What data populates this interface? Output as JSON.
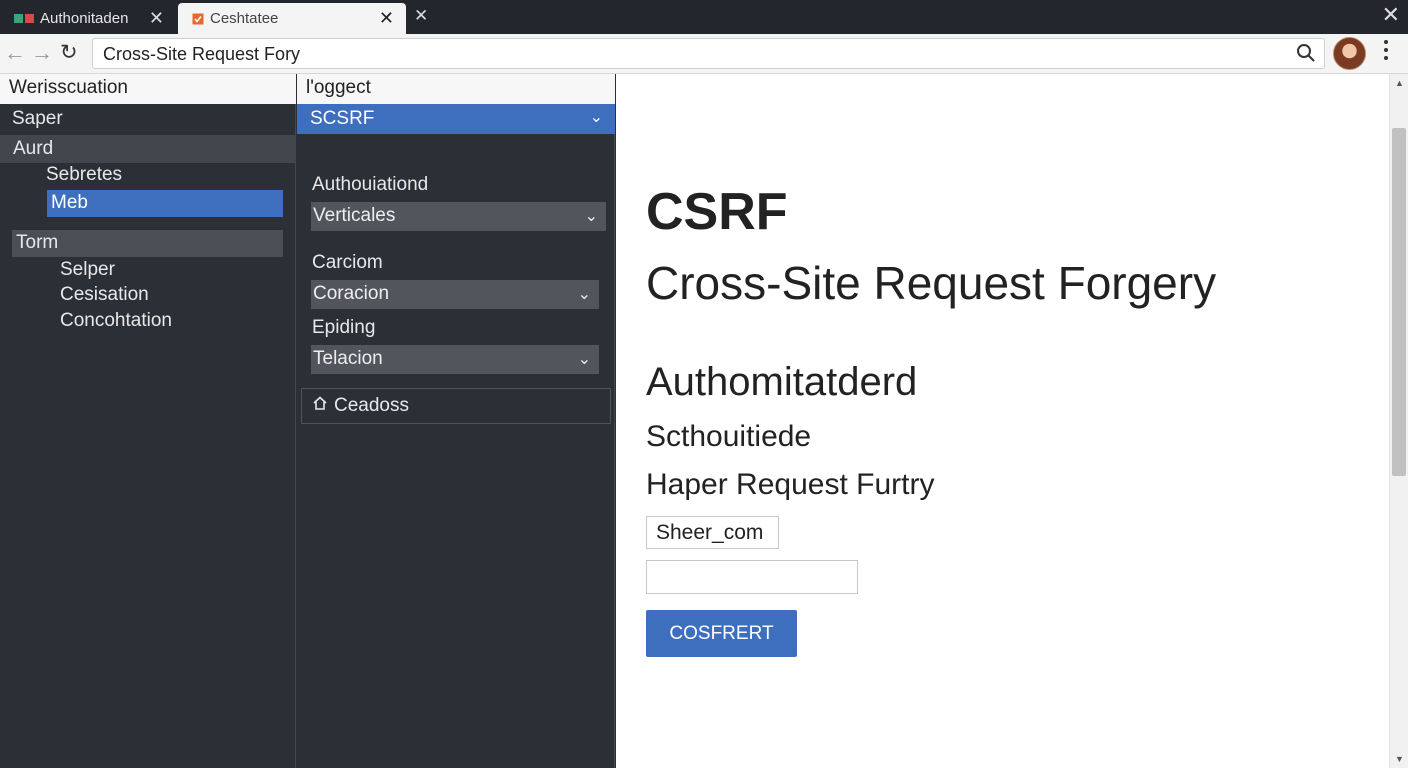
{
  "tabs": [
    {
      "title": "Authonitaden",
      "close": "✕"
    },
    {
      "title": "Ceshtatee",
      "close": "✕"
    }
  ],
  "new_tab_symbol": "✕",
  "window_close_symbol": "✕",
  "toolbar": {
    "back": "←",
    "forward": "→",
    "reload": "↻",
    "url": "Cross-Site Request Fory"
  },
  "sidebar": {
    "header": "Werisscuation",
    "items": [
      "Saper",
      "Aurd",
      "Sebretes",
      "Meb",
      "Torm",
      "Selper",
      "Cesisation",
      "Concohtation"
    ]
  },
  "middle": {
    "header": "l'oggect",
    "select": "SCSRF",
    "fields": [
      {
        "label": "Authouiationd",
        "value": "Verticales"
      },
      {
        "label": "Carciom",
        "value": "Coracion"
      },
      {
        "label": "Epiding",
        "value": "Telacion"
      }
    ],
    "button": "Ceadoss"
  },
  "main": {
    "title": "CSRF",
    "subtitle": "Cross-Site Request Forgery",
    "section": "Authomitatderd",
    "line1": "Scthouitiede",
    "line2": "Haper Request Furtry",
    "input_value": "Sheer_com",
    "input2_value": "",
    "button": "COSFRERT"
  },
  "colors": {
    "accent": "#3e6fbf",
    "sidebar_bg": "#2b2f36",
    "tabbar_bg": "#23262c"
  },
  "icons": [
    "tab-favicon",
    "close-icon",
    "back-arrow-icon",
    "forward-arrow-icon",
    "reload-icon",
    "search-icon",
    "avatar",
    "kebab-menu-icon",
    "chevron-down-icon",
    "home-icon",
    "scroll-up-icon",
    "scroll-down-icon"
  ]
}
